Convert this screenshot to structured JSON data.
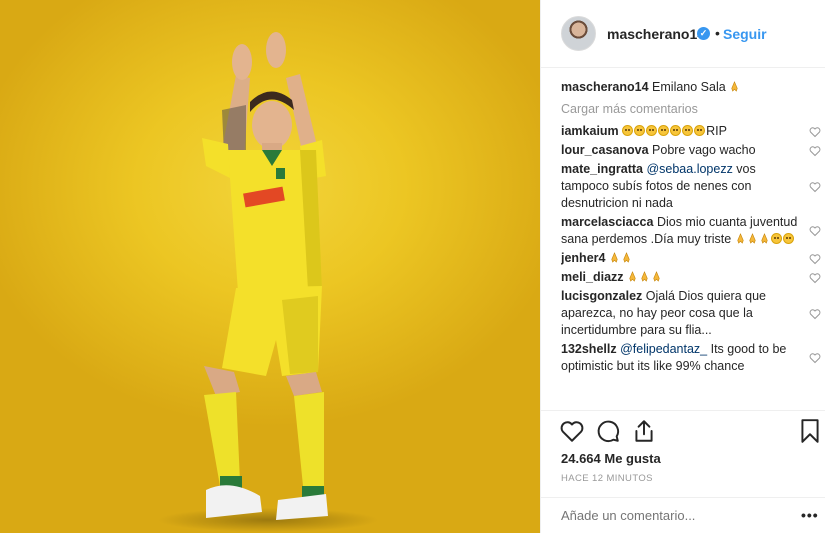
{
  "post": {
    "image_description": "Footballer in yellow kit applauding",
    "colors": {
      "kit": "#f4e02a",
      "kit_shadow": "#cbb513",
      "background": "#ecc623",
      "skin": "#e0b08a"
    }
  },
  "header": {
    "username": "mascherano14",
    "dot": "•",
    "follow_label": "Seguir"
  },
  "caption": {
    "username": "mascherano14",
    "text": "Emilano Sala"
  },
  "load_more_label": "Cargar más comentarios",
  "comments": [
    {
      "username": "iamkaium",
      "text": "RIP"
    },
    {
      "username": "lour_casanova",
      "text": "Pobre vago wacho"
    },
    {
      "username": "mate_ingratta",
      "mention": "@sebaa.lopezz",
      "text": " vos tampoco subís fotos de nenes con desnutricion ni nada"
    },
    {
      "username": "marcelasciacca",
      "text": "Dios mio cuanta juventud sana perdemos .Día muy triste"
    },
    {
      "username": "jenher4",
      "text": ""
    },
    {
      "username": "meli_diazz",
      "text": ""
    },
    {
      "username": "lucisgonzalez",
      "text": "Ojalá Dios quiera que aparezca, no hay peor cosa que la incertidumbre para su flia..."
    },
    {
      "username": "132shellz",
      "mention": "@felipedantaz_",
      "text": " Its good to be optimistic but its like 99% chance"
    }
  ],
  "actions": {
    "likes": "24.664 Me gusta",
    "time": "HACE 12 MINUTOS",
    "add_comment_placeholder": "Añade un comentario...",
    "more_label": "•••"
  },
  "icons": [
    "heart-icon",
    "comment-icon",
    "share-icon",
    "bookmark-icon",
    "verified-icon",
    "sad-emoji-icon",
    "pray-emoji-icon"
  ]
}
